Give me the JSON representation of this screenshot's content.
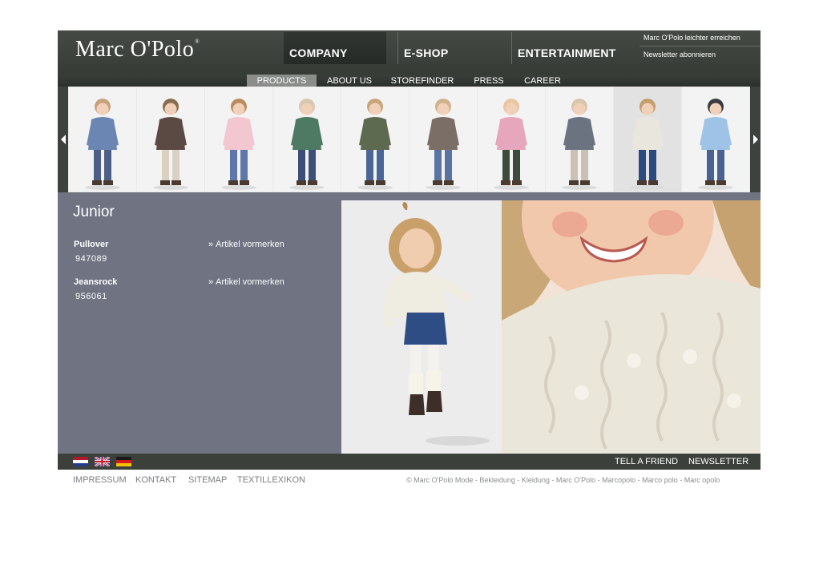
{
  "header": {
    "logo_text": "Marc O'Polo",
    "logo_mark": "®",
    "main_nav": [
      "COMPANY",
      "E-SHOP",
      "ENTERTAINMENT"
    ],
    "utility_links": [
      "Marc O'Polo leichter erreichen",
      "Newsletter abonnieren"
    ]
  },
  "subnav": {
    "items": [
      "PRODUCTS",
      "ABOUT US",
      "STOREFINDER",
      "PRESS",
      "CAREER"
    ],
    "active": "PRODUCTS"
  },
  "thumbnails": {
    "count": 10,
    "active_index": 8,
    "prev_icon": "triangle-left-icon",
    "next_icon": "triangle-right-icon"
  },
  "content": {
    "category": "Junior",
    "products": [
      {
        "name": "Pullover",
        "code": "947089",
        "link": "Artikel vormerken"
      },
      {
        "name": "Jeansrock",
        "code": "956061",
        "link": "Artikel vormerken"
      }
    ],
    "link_icon": "double-chevron-right-icon"
  },
  "footer": {
    "flags": [
      "flag-nl-icon",
      "flag-uk-icon",
      "flag-de-icon"
    ],
    "links": [
      "TELL A FRIEND",
      "NEWSLETTER"
    ],
    "bottom_links": [
      "IMPRESSUM",
      "KONTAKT",
      "SITEMAP",
      "TEXTILLEXIKON"
    ],
    "copyright": "© Marc O'Polo Mode - Bekleidung - Kleidung - Marc O'Polo - Marcopolo - Marco polo - Marc opolo"
  },
  "colors": {
    "header_bg": "#3e433e",
    "content_bg": "#6f7382",
    "subnav_active": "#8a8d8a",
    "text_light": "#ffffff",
    "bottom_link": "#7b7e84"
  }
}
